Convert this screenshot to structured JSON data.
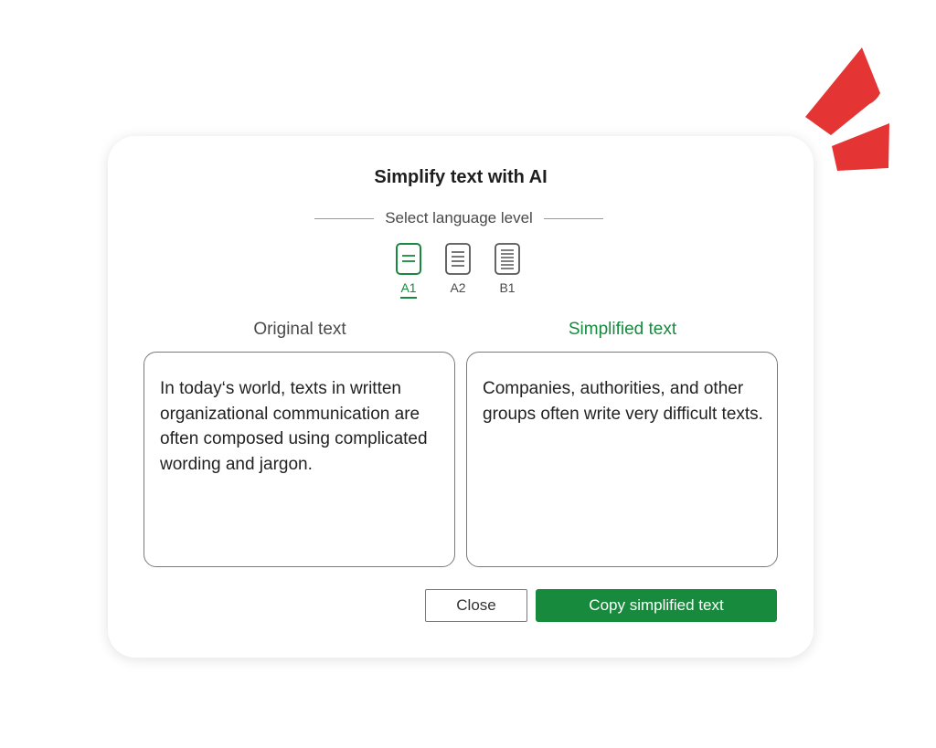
{
  "colors": {
    "accent_green": "#178a3d",
    "accent_red": "#e53434",
    "text_dark": "#1e1e1e",
    "text_muted": "#4a4a4a"
  },
  "dialog": {
    "title": "Simplify text with AI",
    "level_heading": "Select language level",
    "levels": [
      {
        "label": "A1",
        "icon": "document-two-lines-icon",
        "selected": true
      },
      {
        "label": "A2",
        "icon": "document-four-lines-icon",
        "selected": false
      },
      {
        "label": "B1",
        "icon": "document-six-lines-icon",
        "selected": false
      }
    ],
    "original_label": "Original text",
    "original_text": "In today‘s world, texts in written organizational communication are often composed using complicated wording and jargon.",
    "simplified_label": "Simplified text",
    "simplified_text": "Companies, authorities, and other groups often write very difficult texts.",
    "close_label": "Close",
    "copy_label": "Copy simplified text"
  }
}
